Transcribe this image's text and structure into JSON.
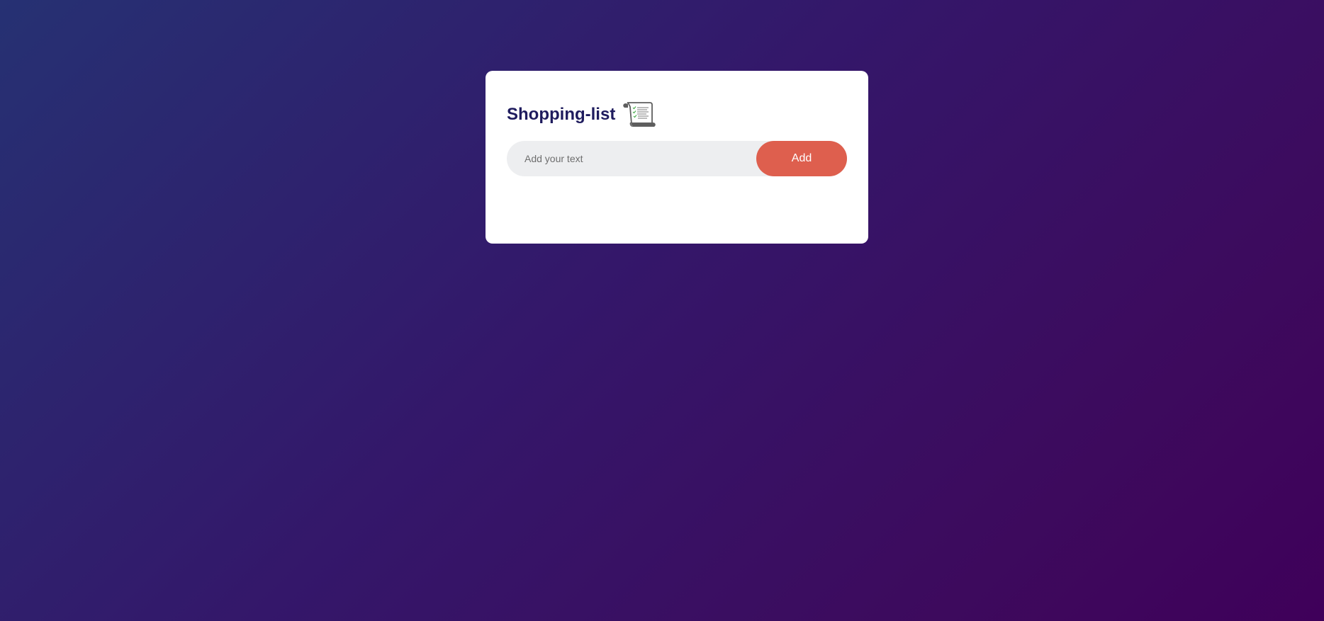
{
  "app": {
    "title": "Shopping-list",
    "title_icon": "scroll-icon"
  },
  "input": {
    "placeholder": "Add your text",
    "value": ""
  },
  "add_button": {
    "label": "Add",
    "color": "#de5f4e"
  },
  "colors": {
    "title": "#1f1c5e",
    "background_start": "#263173",
    "background_end": "#3f005a",
    "card": "#ffffff",
    "input_bg": "#edeef0"
  },
  "items": []
}
